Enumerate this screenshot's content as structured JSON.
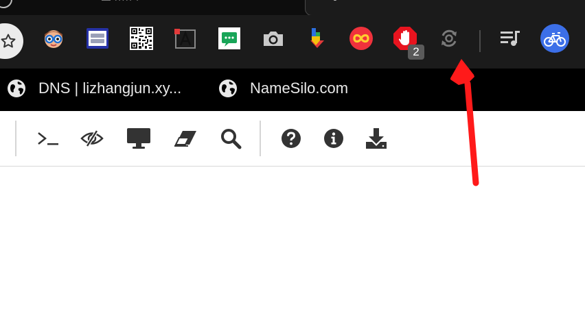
{
  "tabs": {
    "partial_title": "— ·····  ·",
    "active_tab_label": ""
  },
  "extensions": {
    "blocker_badge_count": "2"
  },
  "bookmarks": [
    {
      "label": "DNS | lizhangjun.xy..."
    },
    {
      "label": "NameSilo.com"
    }
  ],
  "colors": {
    "chrome_bg": "#1b1b1b",
    "bookmarks_bg": "#000000",
    "arrow": "#ff1a1a",
    "tool_icon": "#333333"
  }
}
